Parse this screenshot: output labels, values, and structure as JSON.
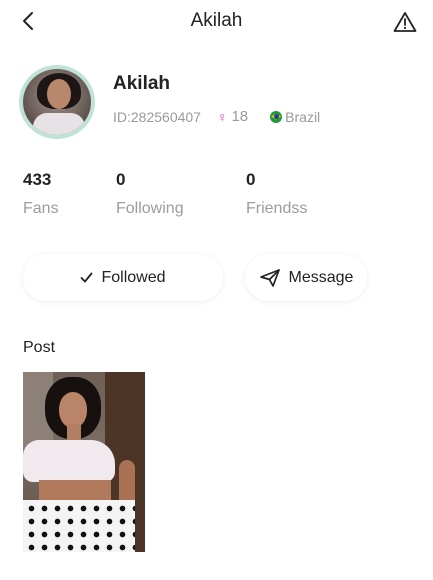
{
  "header": {
    "title": "Akilah",
    "back_icon": "chevron-left-icon",
    "report_icon": "warning-triangle-icon"
  },
  "profile": {
    "name": "Akilah",
    "id_text": "ID:282560407",
    "gender_symbol": "♀",
    "age": "18",
    "country": "Brazil",
    "accent_color": "#e042c5"
  },
  "stats": [
    {
      "value": "433",
      "label": "Fans"
    },
    {
      "value": "0",
      "label": "Following"
    },
    {
      "value": "0",
      "label": "Friendss"
    }
  ],
  "actions": {
    "followed_label": "Followed",
    "message_label": "Message"
  },
  "posts": {
    "section_title": "Post"
  }
}
